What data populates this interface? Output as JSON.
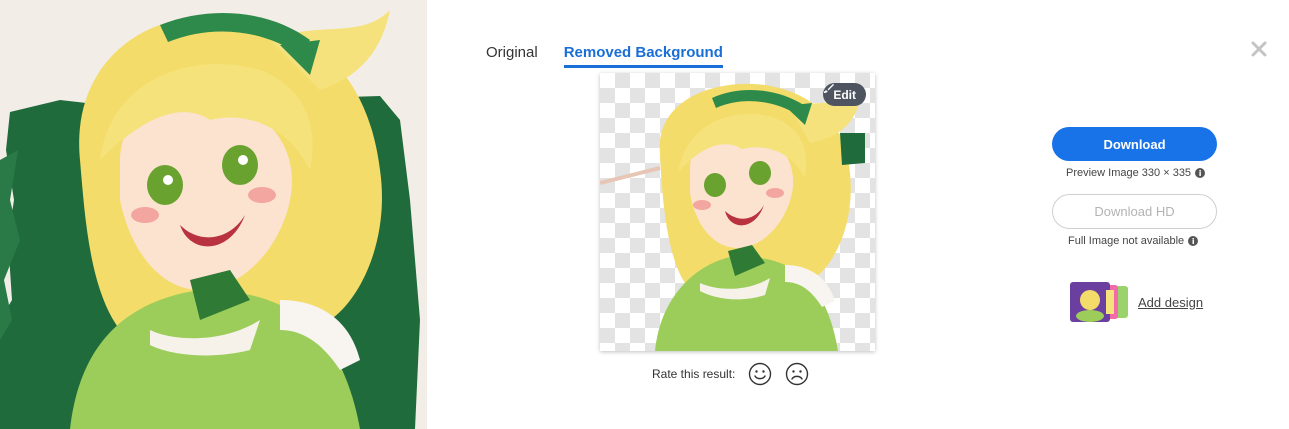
{
  "tabs": [
    {
      "label": "Original",
      "active": false
    },
    {
      "label": "Removed Background",
      "active": true
    }
  ],
  "preview": {
    "edit_label": "Edit"
  },
  "rating": {
    "label": "Rate this result:"
  },
  "actions": {
    "download_label": "Download",
    "preview_note": "Preview Image 330 × 335",
    "download_hd_label": "Download HD",
    "full_note": "Full Image not available",
    "add_design_label": "Add design"
  },
  "colors": {
    "accent": "#1973e8",
    "tab_active": "#1a6fd6",
    "edit_bg": "#4e5560",
    "disabled_text": "#b3b3b3",
    "original_bg_green": "#1f6b3c"
  },
  "icons": {
    "edit": "paintbrush-icon",
    "close": "close-icon",
    "info": "info-icon",
    "happy": "smiley-face-icon",
    "sad": "frowning-face-icon"
  }
}
